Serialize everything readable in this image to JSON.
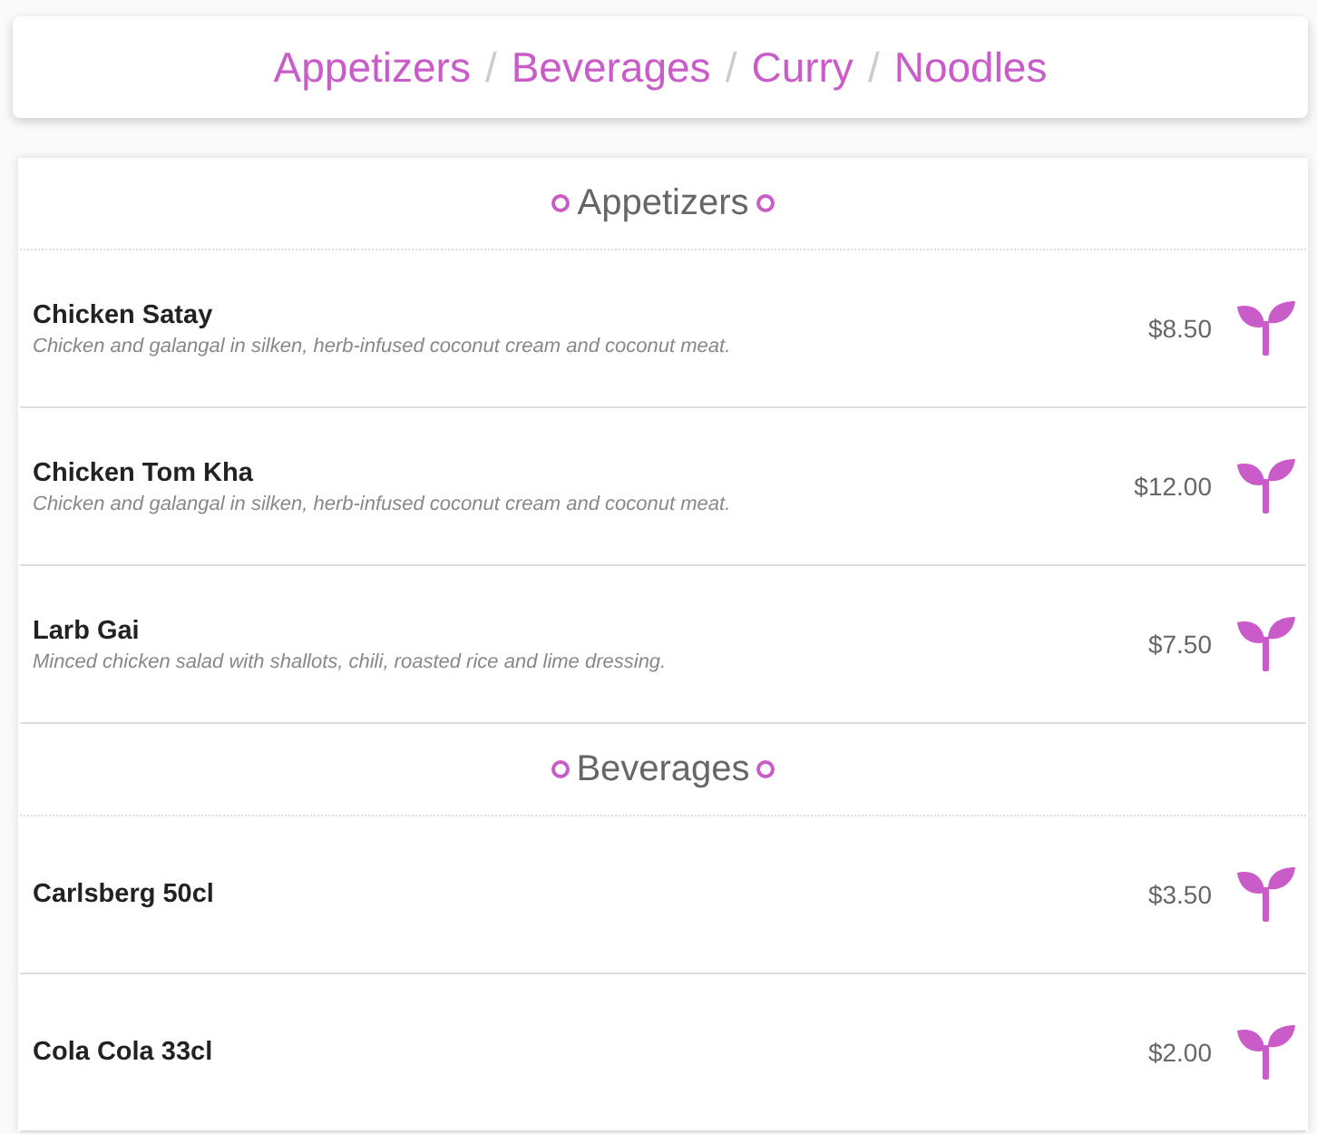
{
  "nav": {
    "links": [
      {
        "label": "Appetizers"
      },
      {
        "label": "Beverages"
      },
      {
        "label": "Curry"
      },
      {
        "label": "Noodles"
      }
    ],
    "separator": "/"
  },
  "sections": [
    {
      "title": "Appetizers",
      "items": [
        {
          "name": "Chicken Satay",
          "description": "Chicken and galangal in silken, herb-infused coconut cream and coconut meat.",
          "price": "$8.50"
        },
        {
          "name": "Chicken Tom Kha",
          "description": "Chicken and galangal in silken, herb-infused coconut cream and coconut meat.",
          "price": "$12.00"
        },
        {
          "name": "Larb Gai",
          "description": "Minced chicken salad with shallots, chili, roasted rice and lime dressing.",
          "price": "$7.50"
        }
      ]
    },
    {
      "title": "Beverages",
      "items": [
        {
          "name": "Carlsberg 50cl",
          "price": "$3.50"
        },
        {
          "name": "Cola Cola 33cl",
          "price": "$2.00"
        }
      ]
    }
  ]
}
